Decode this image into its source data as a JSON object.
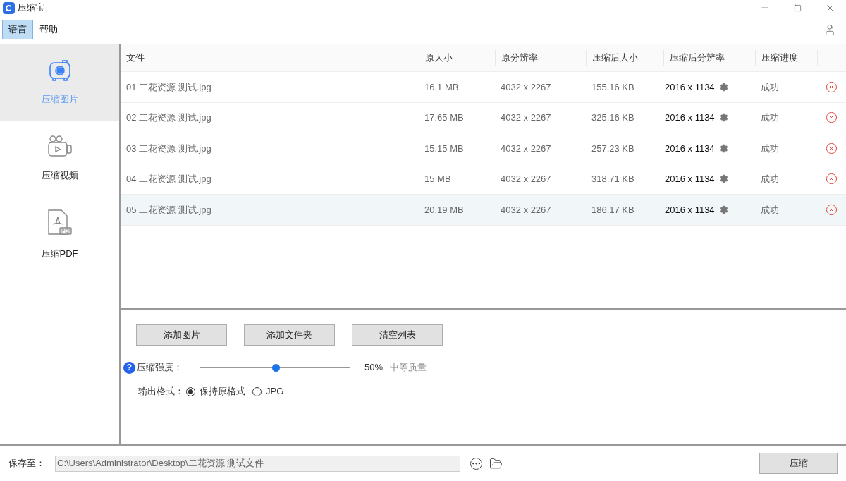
{
  "window": {
    "title": "压缩宝"
  },
  "menu": [
    {
      "label": "语言",
      "selected": true
    },
    {
      "label": "帮助",
      "selected": false
    }
  ],
  "sidebar": {
    "items": [
      {
        "kind": "image",
        "label": "压缩图片",
        "selected": true
      },
      {
        "kind": "video",
        "label": "压缩视频",
        "selected": false
      },
      {
        "kind": "pdf",
        "label": "压缩PDF",
        "selected": false
      }
    ]
  },
  "table": {
    "columns": [
      "文件",
      "原大小",
      "原分辨率",
      "压缩后大小",
      "压缩后分辨率",
      "压缩进度"
    ],
    "rows": [
      {
        "file": "01 二花资源 测试.jpg",
        "size": "16.1 MB",
        "resolution": "4032 x 2267",
        "new_size": "155.16 KB",
        "new_resolution": "2016 x 1134",
        "progress": "成功",
        "selected": false
      },
      {
        "file": "02 二花资源 测试.jpg",
        "size": "17.65 MB",
        "resolution": "4032 x 2267",
        "new_size": "325.16 KB",
        "new_resolution": "2016 x 1134",
        "progress": "成功",
        "selected": false
      },
      {
        "file": "03 二花资源 测试.jpg",
        "size": "15.15 MB",
        "resolution": "4032 x 2267",
        "new_size": "257.23 KB",
        "new_resolution": "2016 x 1134",
        "progress": "成功",
        "selected": false
      },
      {
        "file": "04 二花资源 测试.jpg",
        "size": "15 MB",
        "resolution": "4032 x 2267",
        "new_size": "318.71 KB",
        "new_resolution": "2016 x 1134",
        "progress": "成功",
        "selected": false
      },
      {
        "file": "05 二花资源 测试.jpg",
        "size": "20.19 MB",
        "resolution": "4032 x 2267",
        "new_size": "186.17 KB",
        "new_resolution": "2016 x 1134",
        "progress": "成功",
        "selected": true
      }
    ]
  },
  "actions": [
    "添加图片",
    "添加文件夹",
    "清空列表"
  ],
  "compression": {
    "help": "?",
    "label": "压缩强度：",
    "level": 0.5,
    "reading": "50%",
    "quality": "中等质量"
  },
  "output_format": {
    "label": "输出格式：",
    "options": [
      {
        "label": "保持原格式",
        "selected": true
      },
      {
        "label": "JPG",
        "selected": false
      }
    ]
  },
  "footer": {
    "label": "保存至：",
    "path": "C:\\Users\\Administrator\\Desktop\\二花资源 测试文件",
    "compress_button": "压缩"
  }
}
